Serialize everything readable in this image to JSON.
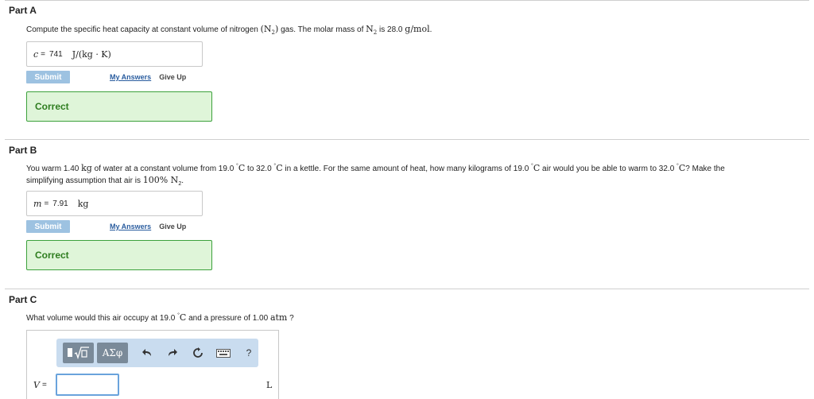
{
  "parts": {
    "a": {
      "title": "Part A",
      "question_prefix": "Compute the specific heat capacity at constant volume of nitrogen ",
      "question_math1": "(N",
      "question_sub1": "2",
      "question_math1_close": ")",
      "question_mid": " gas. The molar mass of ",
      "question_math2": "N",
      "question_sub2": "2",
      "question_mid2": " is 28.0 ",
      "question_math3": "g/mol",
      "question_end": ".",
      "answer_var": "c",
      "answer_eq": "=",
      "answer_value": "741",
      "answer_unit": "J/(kg · K)",
      "submit_label": "Submit",
      "my_answers_label": "My Answers",
      "give_up_label": "Give Up",
      "status_label": "Correct"
    },
    "b": {
      "title": "Part B",
      "q1": "You warm 1.40 ",
      "q1m": "kg",
      "q2": " of water at a constant volume from 19.0 ",
      "q2m": "C",
      "q3": " to 32.0 ",
      "q3m": "C",
      "q4": " in a kettle. For the same amount of heat, how many kilograms of 19.0 ",
      "q4m": "C",
      "q5": " air would you be able to warm to 32.0 ",
      "q5m": "C",
      "q6": "? Make the",
      "q7": "simplifying assumption that air is ",
      "q7m": "100%",
      "q7n": " N",
      "q7sub": "2",
      "q8": ".",
      "deg": "°",
      "answer_var": "m",
      "answer_eq": "=",
      "answer_value": "7.91",
      "answer_unit": "kg",
      "submit_label": "Submit",
      "my_answers_label": "My Answers",
      "give_up_label": "Give Up",
      "status_label": "Correct"
    },
    "c": {
      "title": "Part C",
      "q1": "What volume would this air occupy at 19.0 ",
      "q1m": "C",
      "q2": " and a pressure of 1.00 ",
      "q2m": "atm",
      "q3": " ?",
      "deg": "°",
      "greek_label": "ΑΣφ",
      "help_label": "?",
      "answer_var": "V",
      "answer_eq": "=",
      "answer_value": "",
      "answer_unit": "L"
    }
  },
  "icons": {
    "templates": "templates-icon",
    "undo": "undo-icon",
    "redo": "redo-icon",
    "reset": "reset-icon",
    "keyboard": "keyboard-icon"
  },
  "colors": {
    "correct_bg": "#dff5d9",
    "correct_border": "#3ca13c",
    "submit_bg": "#9dc2e1",
    "toolbar_bg": "#c9dcef",
    "link": "#2a5d9f"
  }
}
